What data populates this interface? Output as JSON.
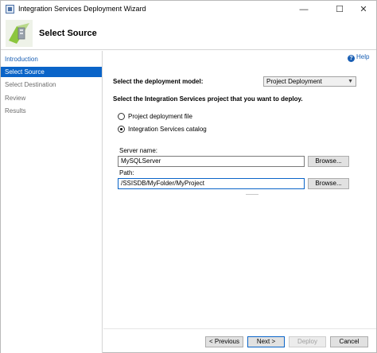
{
  "window": {
    "title": "Integration Services Deployment Wizard",
    "controls": {
      "minimize": "—",
      "maximize": "☐",
      "close": "✕"
    }
  },
  "header": {
    "title": "Select Source"
  },
  "nav": {
    "items": [
      {
        "label": "Introduction",
        "state": "link"
      },
      {
        "label": "Select Source",
        "state": "active"
      },
      {
        "label": "Select Destination",
        "state": "inactive"
      },
      {
        "label": "Review",
        "state": "inactive"
      },
      {
        "label": "Results",
        "state": "inactive"
      }
    ]
  },
  "help": {
    "label": "Help",
    "icon": "?"
  },
  "form": {
    "deployment_model_label": "Select the deployment model:",
    "deployment_model_value": "Project Deployment",
    "project_prompt": "Select the Integration Services project that you want to deploy.",
    "option_file_label": "Project deployment file",
    "option_catalog_label": "Integration Services catalog",
    "selected_option": "catalog",
    "server_name_label": "Server name:",
    "server_name_value": "MySQLServer",
    "path_label": "Path:",
    "path_value": "/SSISDB/MyFolder/MyProject",
    "browse_label": "Browse..."
  },
  "footer": {
    "previous_label": "< Previous",
    "next_label": "Next >",
    "deploy_label": "Deploy",
    "cancel_label": "Cancel"
  },
  "colors": {
    "accent": "#0a64c8",
    "link": "#1a5fb4"
  }
}
